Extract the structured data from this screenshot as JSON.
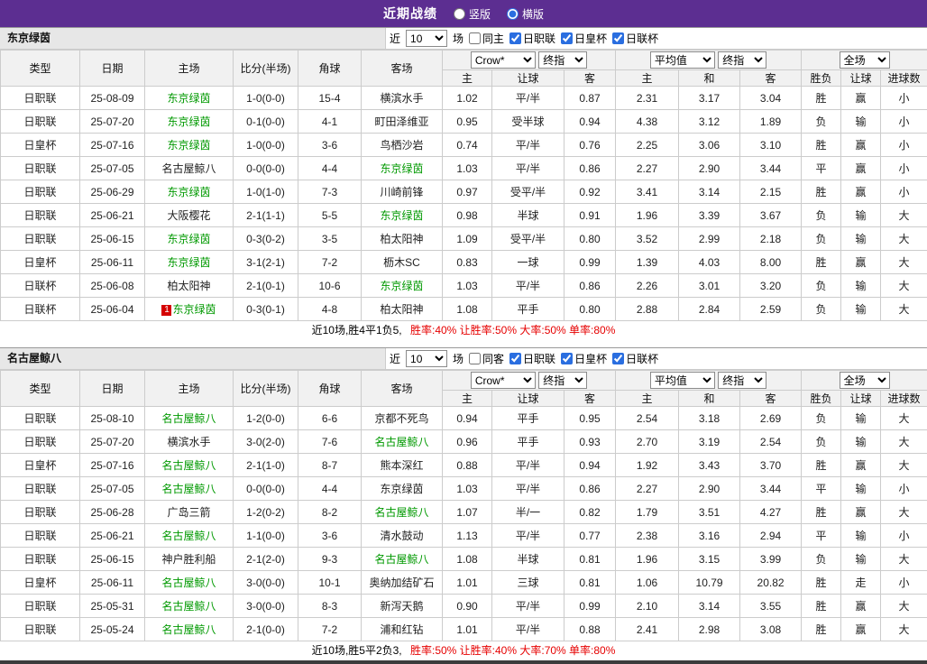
{
  "topbar": {
    "title": "近期战绩",
    "vertical_label": "竖版",
    "horizontal_label": "横版",
    "vertical_selected": false,
    "horizontal_selected": true
  },
  "controls_labels": {
    "recent": "近",
    "matches": "场"
  },
  "headers": {
    "type": "类型",
    "date": "日期",
    "home": "主场",
    "score": "比分(半场)",
    "corner": "角球",
    "away": "客场",
    "crow_select": "Crow*",
    "final_select": "终指",
    "avg_select": "平均值",
    "final_select2": "终指",
    "scope_select": "全场",
    "home_odds": "主",
    "handicap": "让球",
    "away_odds": "客",
    "avg_home": "主",
    "avg_draw": "和",
    "avg_away": "客",
    "result": "胜负",
    "handicap_result": "让球",
    "goals": "进球数"
  },
  "colors": {
    "accent_purple": "#5c2e91",
    "checkbox_blue": "#2a6ee0",
    "league_jleague": "#009933",
    "league_emperor_cup": "#000000",
    "league_league_cup": "#5a8f5a",
    "score_red": "#e60000",
    "focus_green": "#009900",
    "odds_blue": "#00008b",
    "result_red": "#e60000",
    "result_green": "#009900",
    "result_blue": "#0000e0"
  },
  "sections": [
    {
      "team": "东京绿茵",
      "controls": {
        "count": "10",
        "same_label": "同主",
        "same_checked": false,
        "leagues": [
          {
            "label": "日职联",
            "checked": true
          },
          {
            "label": "日皇杯",
            "checked": true
          },
          {
            "label": "日联杯",
            "checked": true
          }
        ]
      },
      "rows": [
        {
          "league": "日职联",
          "date": "25-08-09",
          "home": "东京绿茵",
          "score": "1-0(0-0)",
          "corner": "15-4",
          "away": "横滨水手",
          "odds_home": "1.02",
          "handicap": "平/半",
          "odds_away": "0.87",
          "avg_home": "2.31",
          "avg_draw": "3.17",
          "avg_away": "3.04",
          "result": "胜",
          "handicap_result": "赢",
          "goals": "小"
        },
        {
          "league": "日职联",
          "date": "25-07-20",
          "home": "东京绿茵",
          "score": "0-1(0-0)",
          "corner": "4-1",
          "away": "町田泽维亚",
          "odds_home": "0.95",
          "handicap": "受半球",
          "odds_away": "0.94",
          "avg_home": "4.38",
          "avg_draw": "3.12",
          "avg_away": "1.89",
          "result": "负",
          "handicap_result": "输",
          "goals": "小"
        },
        {
          "league": "日皇杯",
          "date": "25-07-16",
          "home": "东京绿茵",
          "score": "1-0(0-0)",
          "corner": "3-6",
          "away": "鸟栖沙岩",
          "odds_home": "0.74",
          "handicap": "平/半",
          "odds_away": "0.76",
          "avg_home": "2.25",
          "avg_draw": "3.06",
          "avg_away": "3.10",
          "result": "胜",
          "handicap_result": "赢",
          "goals": "小"
        },
        {
          "league": "日职联",
          "date": "25-07-05",
          "home": "名古屋鲸八",
          "score": "0-0(0-0)",
          "corner": "4-4",
          "away": "东京绿茵",
          "odds_home": "1.03",
          "handicap": "平/半",
          "odds_away": "0.86",
          "avg_home": "2.27",
          "avg_draw": "2.90",
          "avg_away": "3.44",
          "result": "平",
          "handicap_result": "赢",
          "goals": "小"
        },
        {
          "league": "日职联",
          "date": "25-06-29",
          "home": "东京绿茵",
          "score": "1-0(1-0)",
          "corner": "7-3",
          "away": "川崎前锋",
          "odds_home": "0.97",
          "handicap": "受平/半",
          "odds_away": "0.92",
          "avg_home": "3.41",
          "avg_draw": "3.14",
          "avg_away": "2.15",
          "result": "胜",
          "handicap_result": "赢",
          "goals": "小"
        },
        {
          "league": "日职联",
          "date": "25-06-21",
          "home": "大阪樱花",
          "score": "2-1(1-1)",
          "corner": "5-5",
          "away": "东京绿茵",
          "odds_home": "0.98",
          "handicap": "半球",
          "odds_away": "0.91",
          "avg_home": "1.96",
          "avg_draw": "3.39",
          "avg_away": "3.67",
          "result": "负",
          "handicap_result": "输",
          "goals": "大"
        },
        {
          "league": "日职联",
          "date": "25-06-15",
          "home": "东京绿茵",
          "score": "0-3(0-2)",
          "corner": "3-5",
          "away": "柏太阳神",
          "odds_home": "1.09",
          "handicap": "受平/半",
          "odds_away": "0.80",
          "avg_home": "3.52",
          "avg_draw": "2.99",
          "avg_away": "2.18",
          "result": "负",
          "handicap_result": "输",
          "goals": "大"
        },
        {
          "league": "日皇杯",
          "date": "25-06-11",
          "home": "东京绿茵",
          "score": "3-1(2-1)",
          "corner": "7-2",
          "away": "枥木SC",
          "odds_home": "0.83",
          "handicap": "一球",
          "odds_away": "0.99",
          "avg_home": "1.39",
          "avg_draw": "4.03",
          "avg_away": "8.00",
          "result": "胜",
          "handicap_result": "赢",
          "goals": "大"
        },
        {
          "league": "日联杯",
          "date": "25-06-08",
          "home": "柏太阳神",
          "score": "2-1(0-1)",
          "corner": "10-6",
          "away": "东京绿茵",
          "odds_home": "1.03",
          "handicap": "平/半",
          "odds_away": "0.86",
          "avg_home": "2.26",
          "avg_draw": "3.01",
          "avg_away": "3.20",
          "result": "负",
          "handicap_result": "输",
          "goals": "大"
        },
        {
          "league": "日联杯",
          "date": "25-06-04",
          "home": "东京绿茵",
          "home_badge": "1",
          "score": "0-3(0-1)",
          "corner": "4-8",
          "away": "柏太阳神",
          "odds_home": "1.08",
          "handicap": "平手",
          "odds_away": "0.80",
          "avg_home": "2.88",
          "avg_draw": "2.84",
          "avg_away": "2.59",
          "result": "负",
          "handicap_result": "输",
          "goals": "大"
        }
      ],
      "footer": {
        "record": "近10场,胜4平1负5,",
        "stats": "胜率:40% 让胜率:50% 大率:50% 单率:80%"
      }
    },
    {
      "team": "名古屋鲸八",
      "controls": {
        "count": "10",
        "same_label": "同客",
        "same_checked": false,
        "leagues": [
          {
            "label": "日职联",
            "checked": true
          },
          {
            "label": "日皇杯",
            "checked": true
          },
          {
            "label": "日联杯",
            "checked": true
          }
        ]
      },
      "rows": [
        {
          "league": "日职联",
          "date": "25-08-10",
          "home": "名古屋鲸八",
          "score": "1-2(0-0)",
          "corner": "6-6",
          "away": "京都不死鸟",
          "odds_home": "0.94",
          "handicap": "平手",
          "odds_away": "0.95",
          "avg_home": "2.54",
          "avg_draw": "3.18",
          "avg_away": "2.69",
          "result": "负",
          "handicap_result": "输",
          "goals": "大"
        },
        {
          "league": "日职联",
          "date": "25-07-20",
          "home": "横滨水手",
          "score": "3-0(2-0)",
          "corner": "7-6",
          "away": "名古屋鲸八",
          "odds_home": "0.96",
          "handicap": "平手",
          "odds_away": "0.93",
          "avg_home": "2.70",
          "avg_draw": "3.19",
          "avg_away": "2.54",
          "result": "负",
          "handicap_result": "输",
          "goals": "大"
        },
        {
          "league": "日皇杯",
          "date": "25-07-16",
          "home": "名古屋鲸八",
          "score": "2-1(1-0)",
          "corner": "8-7",
          "away": "熊本深红",
          "odds_home": "0.88",
          "handicap": "平/半",
          "odds_away": "0.94",
          "avg_home": "1.92",
          "avg_draw": "3.43",
          "avg_away": "3.70",
          "result": "胜",
          "handicap_result": "赢",
          "goals": "大"
        },
        {
          "league": "日职联",
          "date": "25-07-05",
          "home": "名古屋鲸八",
          "score": "0-0(0-0)",
          "corner": "4-4",
          "away": "东京绿茵",
          "odds_home": "1.03",
          "handicap": "平/半",
          "odds_away": "0.86",
          "avg_home": "2.27",
          "avg_draw": "2.90",
          "avg_away": "3.44",
          "result": "平",
          "handicap_result": "输",
          "goals": "小"
        },
        {
          "league": "日职联",
          "date": "25-06-28",
          "home": "广岛三箭",
          "score": "1-2(0-2)",
          "corner": "8-2",
          "away": "名古屋鲸八",
          "odds_home": "1.07",
          "handicap": "半/一",
          "odds_away": "0.82",
          "avg_home": "1.79",
          "avg_draw": "3.51",
          "avg_away": "4.27",
          "result": "胜",
          "handicap_result": "赢",
          "goals": "大"
        },
        {
          "league": "日职联",
          "date": "25-06-21",
          "home": "名古屋鲸八",
          "score": "1-1(0-0)",
          "corner": "3-6",
          "away": "清水鼓动",
          "odds_home": "1.13",
          "handicap": "平/半",
          "odds_away": "0.77",
          "avg_home": "2.38",
          "avg_draw": "3.16",
          "avg_away": "2.94",
          "result": "平",
          "handicap_result": "输",
          "goals": "小"
        },
        {
          "league": "日职联",
          "date": "25-06-15",
          "home": "神户胜利船",
          "score": "2-1(2-0)",
          "corner": "9-3",
          "away": "名古屋鲸八",
          "odds_home": "1.08",
          "handicap": "半球",
          "odds_away": "0.81",
          "avg_home": "1.96",
          "avg_draw": "3.15",
          "avg_away": "3.99",
          "result": "负",
          "handicap_result": "输",
          "goals": "大"
        },
        {
          "league": "日皇杯",
          "date": "25-06-11",
          "home": "名古屋鲸八",
          "score": "3-0(0-0)",
          "corner": "10-1",
          "away": "奥纳加结矿石",
          "odds_home": "1.01",
          "handicap": "三球",
          "odds_away": "0.81",
          "avg_home": "1.06",
          "avg_draw": "10.79",
          "avg_away": "20.82",
          "result": "胜",
          "handicap_result": "走",
          "goals": "小"
        },
        {
          "league": "日职联",
          "date": "25-05-31",
          "home": "名古屋鲸八",
          "score": "3-0(0-0)",
          "corner": "8-3",
          "away": "新泻天鹅",
          "odds_home": "0.90",
          "handicap": "平/半",
          "odds_away": "0.99",
          "avg_home": "2.10",
          "avg_draw": "3.14",
          "avg_away": "3.55",
          "result": "胜",
          "handicap_result": "赢",
          "goals": "大"
        },
        {
          "league": "日职联",
          "date": "25-05-24",
          "home": "名古屋鲸八",
          "score": "2-1(0-0)",
          "corner": "7-2",
          "away": "浦和红钻",
          "odds_home": "1.01",
          "handicap": "平/半",
          "odds_away": "0.88",
          "avg_home": "2.41",
          "avg_draw": "2.98",
          "avg_away": "3.08",
          "result": "胜",
          "handicap_result": "赢",
          "goals": "大"
        }
      ],
      "footer": {
        "record": "近10场,胜5平2负3,",
        "stats": "胜率:50% 让胜率:40% 大率:70% 单率:80%"
      }
    }
  ]
}
